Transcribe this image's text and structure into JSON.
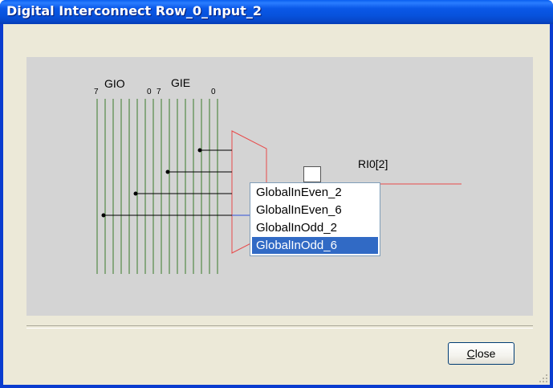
{
  "window": {
    "title": "Digital Interconnect Row_0_Input_2"
  },
  "diagram": {
    "bus_labels": {
      "gio": "GIO",
      "gie": "GIE",
      "gio_high_bit": "7",
      "gio_low_bit": "0",
      "gie_high_bit": "7",
      "gie_low_bit": "0"
    },
    "output_label": "RI0[2]",
    "colors": {
      "bus_lines": "#3a7a2a",
      "mux_and_output": "#e84a4a",
      "selected_connection": "#3050d8",
      "panel_background": "#d4d4d4"
    }
  },
  "input_dropdown": {
    "options": [
      "GlobalInEven_2",
      "GlobalInEven_6",
      "GlobalInOdd_2",
      "GlobalInOdd_6"
    ],
    "selected": "GlobalInOdd_6"
  },
  "buttons": {
    "close_prefix": "C",
    "close_rest": "lose"
  }
}
